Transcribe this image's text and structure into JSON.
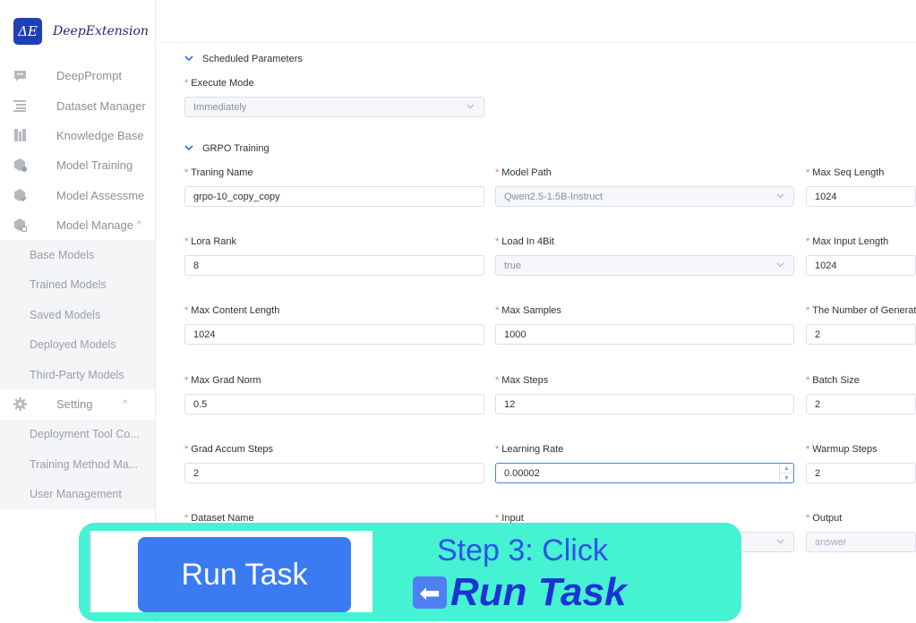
{
  "app": {
    "logo_mark": "ΔE",
    "logo_text": "DeepExtension"
  },
  "sidebar": {
    "items": [
      {
        "label": "DeepPrompt",
        "icon": "chat-icon"
      },
      {
        "label": "Dataset Manager",
        "icon": "list-icon"
      },
      {
        "label": "Knowledge Base",
        "icon": "book-icon"
      },
      {
        "label": "Model Training",
        "icon": "cube-training-icon"
      },
      {
        "label": "Model Assessme",
        "icon": "cube-assess-icon"
      },
      {
        "label": "Model Manage",
        "icon": "cube-manage-icon",
        "chevron": "^"
      }
    ],
    "model_sub": [
      "Base Models",
      "Trained Models",
      "Saved Models",
      "Deployed Models",
      "Third-Party Models"
    ],
    "setting": {
      "label": "Setting",
      "icon": "gear-icon",
      "chevron": "^"
    },
    "setting_sub": [
      "Deployment Tool Co...",
      "Training Method Ma...",
      "User Management"
    ]
  },
  "form": {
    "scheduled": {
      "title": "Scheduled Parameters",
      "execute_mode_label": "Execute Mode",
      "execute_mode_value": "Immediately"
    },
    "grpo": {
      "title": "GRPO Training",
      "fields": {
        "training_name": {
          "label": "Traning Name",
          "value": "grpo-10_copy_copy"
        },
        "model_path": {
          "label": "Model Path",
          "value": "Qwen2.5-1.5B-Instruct"
        },
        "max_seq_length": {
          "label": "Max Seq Length",
          "value": "1024"
        },
        "lora_rank": {
          "label": "Lora Rank",
          "value": "8"
        },
        "load_in_4bit": {
          "label": "Load In 4Bit",
          "value": "true"
        },
        "max_input_length": {
          "label": "Max Input Length",
          "value": "1024"
        },
        "max_content_length": {
          "label": "Max Content Length",
          "value": "1024"
        },
        "max_samples": {
          "label": "Max Samples",
          "value": "1000"
        },
        "num_generations": {
          "label": "The Number of Generat",
          "value": "2"
        },
        "max_grad_norm": {
          "label": "Max Grad Norm",
          "value": "0.5"
        },
        "max_steps": {
          "label": "Max Steps",
          "value": "12"
        },
        "batch_size": {
          "label": "Batch Size",
          "value": "2"
        },
        "grad_accum_steps": {
          "label": "Grad Accum Steps",
          "value": "2"
        },
        "learning_rate": {
          "label": "Learning Rate",
          "value": "0.00002"
        },
        "warmup_steps": {
          "label": "Warmup Steps",
          "value": "2"
        },
        "dataset_name": {
          "label": "Dataset Name"
        },
        "input": {
          "label": "Input"
        },
        "output": {
          "label": "Output",
          "value": "answer"
        }
      }
    }
  },
  "tutorial": {
    "button_label": "Run Task",
    "step_line1": "Step 3: Click",
    "arrow": "⬅",
    "step_line2": "Run Task"
  },
  "colors": {
    "brand": "#1f3fb5",
    "primary": "#3a7bf2",
    "overlay": "#45f2d2",
    "required": "#f56c6c"
  }
}
